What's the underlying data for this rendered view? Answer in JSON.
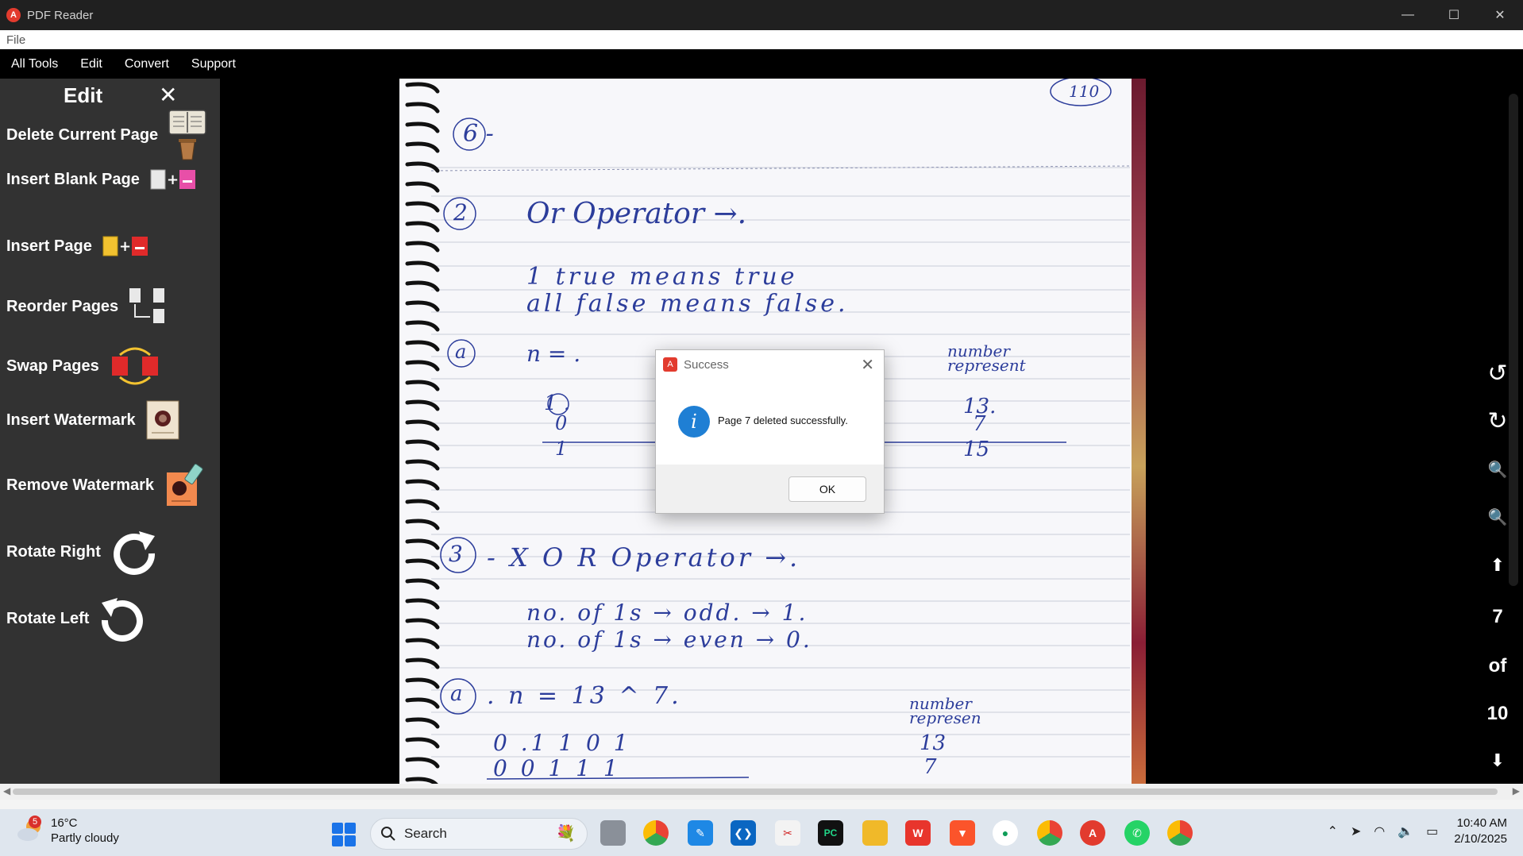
{
  "window": {
    "title": "PDF Reader",
    "minimize": "—",
    "maximize": "☐",
    "close": "✕"
  },
  "filemenu": {
    "file": "File"
  },
  "menubar": {
    "items": [
      "All Tools",
      "Edit",
      "Convert",
      "Support"
    ]
  },
  "edit_panel": {
    "title": "Edit",
    "close": "✕",
    "tools": [
      {
        "label": "Delete Current Page",
        "icon": "delete-page-icon"
      },
      {
        "label": "Insert Blank Page",
        "icon": "insert-blank-page-icon"
      },
      {
        "label": "Insert Page",
        "icon": "insert-page-icon"
      },
      {
        "label": "Reorder Pages",
        "icon": "reorder-pages-icon"
      },
      {
        "label": "Swap Pages",
        "icon": "swap-pages-icon"
      },
      {
        "label": "Insert Watermark",
        "icon": "insert-watermark-icon"
      },
      {
        "label": "Remove Watermark",
        "icon": "remove-watermark-icon"
      },
      {
        "label": "Rotate Right",
        "icon": "rotate-right-icon"
      },
      {
        "label": "Rotate Left",
        "icon": "rotate-left-icon"
      }
    ]
  },
  "page_content": {
    "corner_num": "110",
    "l1": "6 -",
    "l2_num": "2",
    "l2": "Or Operator →.",
    "l3": "1 true means true",
    "l4": "all false means false.",
    "l5_num": "a",
    "l5": "n = .",
    "l5r": "number represent",
    "l6": "1  .",
    "l6r1": "13.",
    "l6r2": "7",
    "l7": "0",
    "l7r": "15",
    "l8": "1",
    "l9_num": "3",
    "l9": "- X O R  Operator →.",
    "l10": "no. of 1s → odd. → 1.",
    "l11": "no. of 1s → even → 0.",
    "l12_num": "a",
    "l12": ". n = 13 ^ 7.",
    "l12r": "number represen",
    "l13": "0 .1  1  0  1",
    "l13r": "13",
    "l14": "0  0  1  1  1",
    "l14r": "7"
  },
  "nav": {
    "rotate_ccw": "↺",
    "rotate_cw": "↻",
    "zoom_out": "🔍",
    "zoom_in": "🔍",
    "up": "⬆",
    "page_current": "7",
    "of": "of",
    "page_total": "10",
    "down": "⬇"
  },
  "dialog": {
    "title": "Success",
    "close": "✕",
    "info": "i",
    "message": "Page 7 deleted successfully.",
    "ok": "OK"
  },
  "taskbar": {
    "weather_badge": "5",
    "temperature": "16°C",
    "condition": "Partly cloudy",
    "search": "Search",
    "time": "10:40 AM",
    "date": "2/10/2025"
  },
  "colors": {
    "accent": "#1f7fd4",
    "ink": "#2c3d9b",
    "panel": "#323232"
  }
}
